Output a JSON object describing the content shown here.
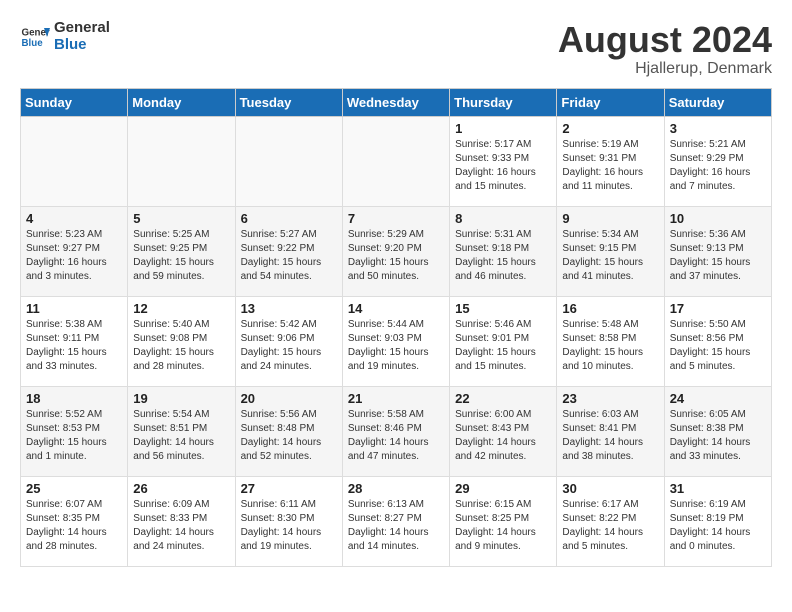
{
  "header": {
    "logo_general": "General",
    "logo_blue": "Blue",
    "month_year": "August 2024",
    "location": "Hjallerup, Denmark"
  },
  "days_of_week": [
    "Sunday",
    "Monday",
    "Tuesday",
    "Wednesday",
    "Thursday",
    "Friday",
    "Saturday"
  ],
  "weeks": [
    {
      "days": [
        {
          "num": "",
          "empty": true
        },
        {
          "num": "",
          "empty": true
        },
        {
          "num": "",
          "empty": true
        },
        {
          "num": "",
          "empty": true
        },
        {
          "num": "1",
          "sunrise": "5:17 AM",
          "sunset": "9:33 PM",
          "daylight": "16 hours and 15 minutes."
        },
        {
          "num": "2",
          "sunrise": "5:19 AM",
          "sunset": "9:31 PM",
          "daylight": "16 hours and 11 minutes."
        },
        {
          "num": "3",
          "sunrise": "5:21 AM",
          "sunset": "9:29 PM",
          "daylight": "16 hours and 7 minutes."
        }
      ]
    },
    {
      "days": [
        {
          "num": "4",
          "sunrise": "5:23 AM",
          "sunset": "9:27 PM",
          "daylight": "16 hours and 3 minutes."
        },
        {
          "num": "5",
          "sunrise": "5:25 AM",
          "sunset": "9:25 PM",
          "daylight": "15 hours and 59 minutes."
        },
        {
          "num": "6",
          "sunrise": "5:27 AM",
          "sunset": "9:22 PM",
          "daylight": "15 hours and 54 minutes."
        },
        {
          "num": "7",
          "sunrise": "5:29 AM",
          "sunset": "9:20 PM",
          "daylight": "15 hours and 50 minutes."
        },
        {
          "num": "8",
          "sunrise": "5:31 AM",
          "sunset": "9:18 PM",
          "daylight": "15 hours and 46 minutes."
        },
        {
          "num": "9",
          "sunrise": "5:34 AM",
          "sunset": "9:15 PM",
          "daylight": "15 hours and 41 minutes."
        },
        {
          "num": "10",
          "sunrise": "5:36 AM",
          "sunset": "9:13 PM",
          "daylight": "15 hours and 37 minutes."
        }
      ]
    },
    {
      "days": [
        {
          "num": "11",
          "sunrise": "5:38 AM",
          "sunset": "9:11 PM",
          "daylight": "15 hours and 33 minutes."
        },
        {
          "num": "12",
          "sunrise": "5:40 AM",
          "sunset": "9:08 PM",
          "daylight": "15 hours and 28 minutes."
        },
        {
          "num": "13",
          "sunrise": "5:42 AM",
          "sunset": "9:06 PM",
          "daylight": "15 hours and 24 minutes."
        },
        {
          "num": "14",
          "sunrise": "5:44 AM",
          "sunset": "9:03 PM",
          "daylight": "15 hours and 19 minutes."
        },
        {
          "num": "15",
          "sunrise": "5:46 AM",
          "sunset": "9:01 PM",
          "daylight": "15 hours and 15 minutes."
        },
        {
          "num": "16",
          "sunrise": "5:48 AM",
          "sunset": "8:58 PM",
          "daylight": "15 hours and 10 minutes."
        },
        {
          "num": "17",
          "sunrise": "5:50 AM",
          "sunset": "8:56 PM",
          "daylight": "15 hours and 5 minutes."
        }
      ]
    },
    {
      "days": [
        {
          "num": "18",
          "sunrise": "5:52 AM",
          "sunset": "8:53 PM",
          "daylight": "15 hours and 1 minute."
        },
        {
          "num": "19",
          "sunrise": "5:54 AM",
          "sunset": "8:51 PM",
          "daylight": "14 hours and 56 minutes."
        },
        {
          "num": "20",
          "sunrise": "5:56 AM",
          "sunset": "8:48 PM",
          "daylight": "14 hours and 52 minutes."
        },
        {
          "num": "21",
          "sunrise": "5:58 AM",
          "sunset": "8:46 PM",
          "daylight": "14 hours and 47 minutes."
        },
        {
          "num": "22",
          "sunrise": "6:00 AM",
          "sunset": "8:43 PM",
          "daylight": "14 hours and 42 minutes."
        },
        {
          "num": "23",
          "sunrise": "6:03 AM",
          "sunset": "8:41 PM",
          "daylight": "14 hours and 38 minutes."
        },
        {
          "num": "24",
          "sunrise": "6:05 AM",
          "sunset": "8:38 PM",
          "daylight": "14 hours and 33 minutes."
        }
      ]
    },
    {
      "days": [
        {
          "num": "25",
          "sunrise": "6:07 AM",
          "sunset": "8:35 PM",
          "daylight": "14 hours and 28 minutes."
        },
        {
          "num": "26",
          "sunrise": "6:09 AM",
          "sunset": "8:33 PM",
          "daylight": "14 hours and 24 minutes."
        },
        {
          "num": "27",
          "sunrise": "6:11 AM",
          "sunset": "8:30 PM",
          "daylight": "14 hours and 19 minutes."
        },
        {
          "num": "28",
          "sunrise": "6:13 AM",
          "sunset": "8:27 PM",
          "daylight": "14 hours and 14 minutes."
        },
        {
          "num": "29",
          "sunrise": "6:15 AM",
          "sunset": "8:25 PM",
          "daylight": "14 hours and 9 minutes."
        },
        {
          "num": "30",
          "sunrise": "6:17 AM",
          "sunset": "8:22 PM",
          "daylight": "14 hours and 5 minutes."
        },
        {
          "num": "31",
          "sunrise": "6:19 AM",
          "sunset": "8:19 PM",
          "daylight": "14 hours and 0 minutes."
        }
      ]
    }
  ],
  "labels": {
    "sunrise": "Sunrise:",
    "sunset": "Sunset:",
    "daylight": "Daylight:"
  }
}
